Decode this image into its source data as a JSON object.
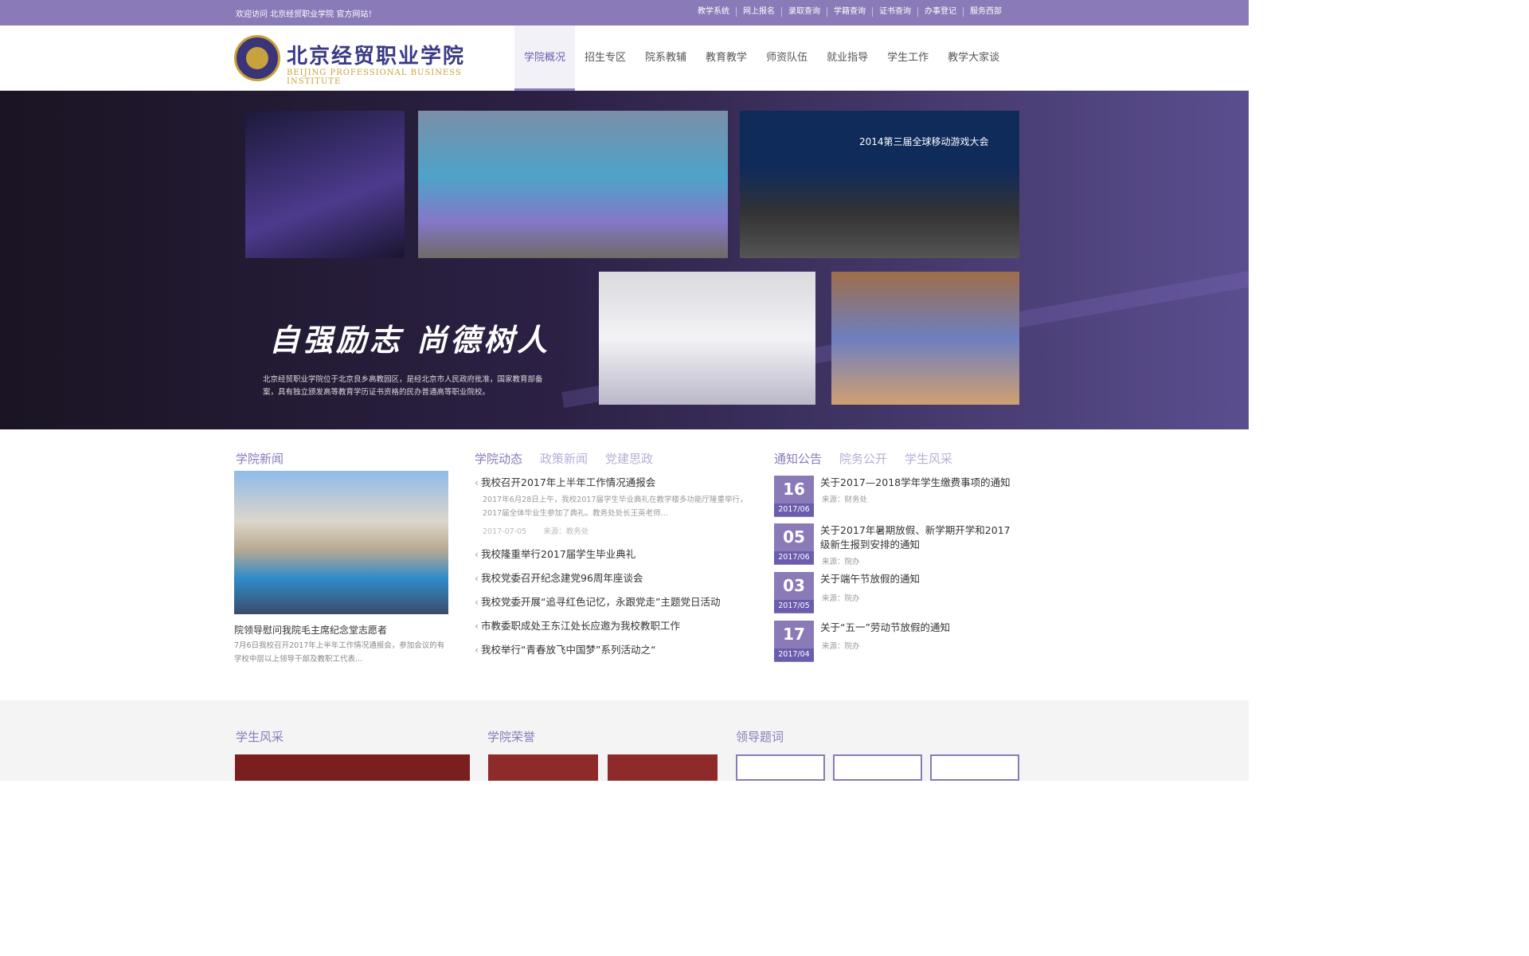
{
  "topbar": {
    "welcome": "欢迎访问 北京经贸职业学院 官方网站！",
    "links": [
      "教学系统",
      "网上报名",
      "录取查询",
      "学籍查询",
      "证书查询",
      "办事登记",
      "服务西部"
    ]
  },
  "logo": {
    "cn": "北京经贸职业学院",
    "en": "BEIJING PROFESSIONAL BUSINESS INSTITUTE"
  },
  "nav": [
    "学院概况",
    "招生专区",
    "院系教辅",
    "教育教学",
    "师资队伍",
    "就业指导",
    "学生工作",
    "教学大家谈"
  ],
  "banner": {
    "slogan": "自强励志 尚德树人",
    "desc": "北京经贸职业学院位于北京良乡高教园区，是经北京市人民政府批准，国家教育部备案，具有独立颁发高等教育学历证书资格的民办普通高等职业院校。",
    "photo3_text": "2014第三届全球移动游戏大会"
  },
  "news": {
    "title": "学院新闻",
    "caption": "院领导慰问我院毛主席纪念堂志愿者",
    "caption_desc": "7月6日我校召开2017年上半年工作情况通报会，参加会议的有学校中层以上领导干部及教职工代表..."
  },
  "dynamics": {
    "tabs": [
      "学院动态",
      "政策新闻",
      "党建思政"
    ],
    "first": {
      "title": "我校召开2017年上半年工作情况通报会",
      "detail": "2017年6月28日上午，我校2017届学生毕业典礼在教学楼多功能厅隆重举行，2017届全体毕业生参加了典礼。教务处处长王英老师...",
      "date": "2017-07-05",
      "source": "来源：教务处"
    },
    "items": [
      "我校隆重举行2017届学生毕业典礼",
      "我校党委召开纪念建党96周年座谈会",
      "我校党委开展“追寻红色记忆，永跟党走”主题党日活动",
      "市教委职成处王东江处长应邀为我校教职工作",
      "我校举行“青春放飞中国梦”系列活动之“"
    ]
  },
  "notices": {
    "tabs": [
      "通知公告",
      "院务公开",
      "学生风采"
    ],
    "items": [
      {
        "day": "16",
        "month": "2017/06",
        "title": "关于2017—2018学年学生缴费事项的通知",
        "source": "来源：财务处"
      },
      {
        "day": "05",
        "month": "2017/06",
        "title": "关于2017年暑期放假、新学期开学和2017级新生报到安排的通知",
        "source": "来源：院办"
      },
      {
        "day": "03",
        "month": "2017/05",
        "title": "关于端午节放假的通知",
        "source": "来源：院办"
      },
      {
        "day": "17",
        "month": "2017/04",
        "title": "关于“五一”劳动节放假的通知",
        "source": "来源：院办"
      }
    ]
  },
  "bottom": {
    "titles": [
      "学生风采",
      "学院荣誉",
      "领导题词"
    ]
  }
}
